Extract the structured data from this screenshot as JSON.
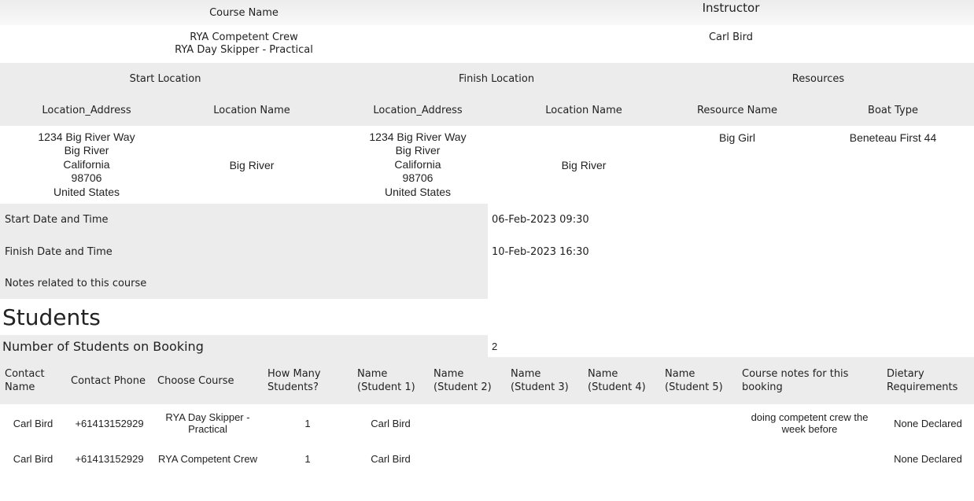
{
  "course": {
    "course_name_label": "Course Name",
    "instructor_label": "Instructor",
    "course_names": [
      "RYA Competent Crew",
      "RYA Day Skipper - Practical"
    ],
    "instructor_name": "Carl Bird"
  },
  "locations": {
    "start_label": "Start Location",
    "finish_label": "Finish Location",
    "resources_label": "Resources",
    "col_location_address": "Location_Address",
    "col_location_name": "Location Name",
    "col_resource_name": "Resource Name",
    "col_boat_type": "Boat Type",
    "start": {
      "address_lines": [
        "1234 Big River Way",
        "Big River",
        "California",
        "98706",
        "United States"
      ],
      "name": "Big River"
    },
    "finish": {
      "address_lines": [
        "1234 Big River Way",
        "Big River",
        "California",
        "98706",
        "United States"
      ],
      "name": "Big River"
    },
    "resource_name": "Big Girl",
    "boat_type": "Beneteau First 44"
  },
  "details": {
    "start_label": "Start Date and Time",
    "start_value": "06-Feb-2023 09:30",
    "finish_label": "Finish Date and Time",
    "finish_value": "10-Feb-2023 16:30",
    "notes_label": "Notes related to this course",
    "notes_value": ""
  },
  "students": {
    "heading": "Students",
    "count_label": "Number of Students on Booking",
    "count_value": "2",
    "columns": [
      "Contact Name",
      "Contact Phone",
      "Choose Course",
      "How Many Students?",
      "Name (Student 1)",
      "Name (Student 2)",
      "Name (Student 3)",
      "Name (Student 4)",
      "Name (Student 5)",
      "Course notes for this booking",
      "Dietary Requirements"
    ],
    "rows": [
      [
        "Carl Bird",
        "+61413152929",
        "RYA Day Skipper - Practical",
        "1",
        "Carl Bird",
        "",
        "",
        "",
        "",
        "doing competent crew the week before",
        "None Declared"
      ],
      [
        "Carl Bird",
        "+61413152929",
        "RYA Competent Crew",
        "1",
        "Carl Bird",
        "",
        "",
        "",
        "",
        "",
        "None Declared"
      ]
    ]
  }
}
